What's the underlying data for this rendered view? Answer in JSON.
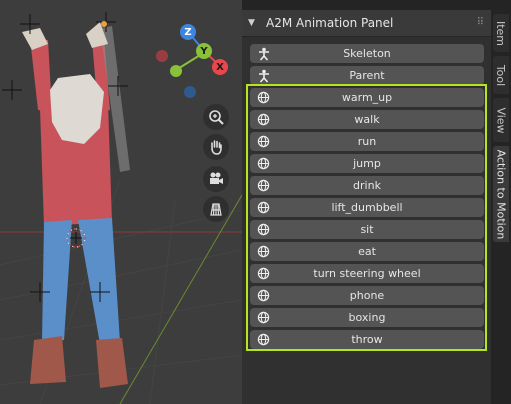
{
  "viewport": {
    "gizmo_axes": {
      "z": "Z",
      "y": "Y",
      "x": "X"
    },
    "tools": [
      {
        "name": "zoom-icon"
      },
      {
        "name": "hand-pan-icon"
      },
      {
        "name": "camera-icon"
      },
      {
        "name": "grid-icon"
      }
    ]
  },
  "panel": {
    "title": "A2M Animation Panel",
    "primary_buttons": [
      "Skeleton",
      "Parent"
    ],
    "motion_buttons": [
      "warm_up",
      "walk",
      "run",
      "jump",
      "drink",
      "lift_dumbbell",
      "sit",
      "eat",
      "turn steering wheel",
      "phone",
      "boxing",
      "throw"
    ]
  },
  "tabs": [
    "Item",
    "Tool",
    "View",
    "Action to Motion"
  ],
  "colors": {
    "highlight": "#b5e61d",
    "axis_x": "#e8474b",
    "axis_y": "#8ac13a",
    "axis_z": "#3d86e0"
  }
}
